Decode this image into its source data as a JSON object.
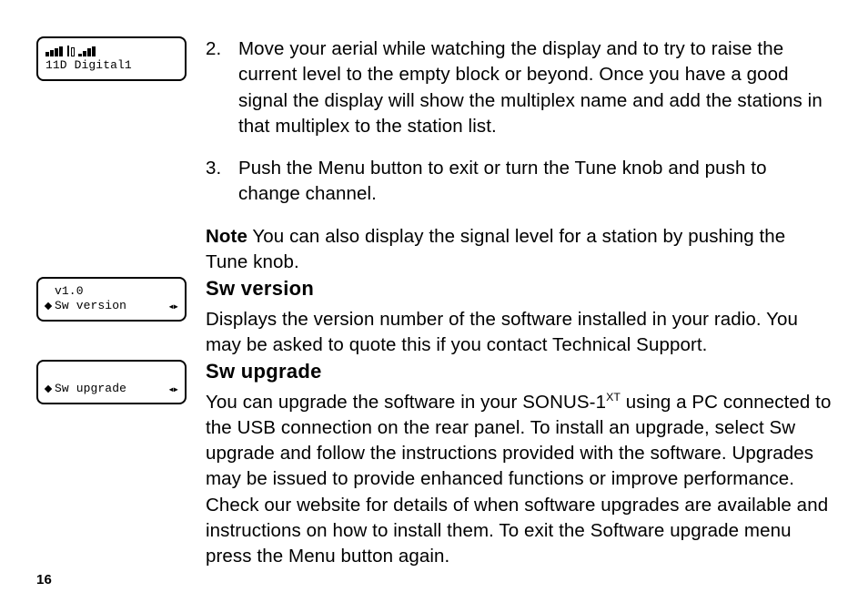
{
  "lcd1": {
    "line2": "11D Digital1"
  },
  "lcd2": {
    "line1": "v1.0",
    "line2": "Sw version"
  },
  "lcd3": {
    "line2": "Sw upgrade"
  },
  "list": {
    "item2_num": "2.",
    "item2_text": "Move your aerial while watching the display and to try to raise the current level to the empty block or beyond. Once you have a good signal the display will show the multiplex name and add the stations in that multiplex to the station list.",
    "item3_num": "3.",
    "item3_text": "Push the Menu button to exit or turn the Tune knob and push to change channel."
  },
  "note": {
    "label": "Note",
    "text": " You can also display the signal level for a station by pushing the Tune knob."
  },
  "section_version": {
    "heading": "Sw version",
    "text": "Displays the version number of the software installed in your radio. You may be asked to quote this if you contact Technical Support."
  },
  "section_upgrade": {
    "heading": "Sw upgrade",
    "text_before_sup": "You can upgrade the software in your SONUS-1",
    "sup": "XT",
    "text_after_sup": " using a PC connected to the USB connection on the rear panel. To install an upgrade, select Sw upgrade and follow the instructions provided with the software. Upgrades may be issued to provide enhanced functions or improve performance. Check our website for details of when software upgrades are available and instructions on how to install them. To exit the Software upgrade menu press the Menu button again."
  },
  "page_number": "16"
}
